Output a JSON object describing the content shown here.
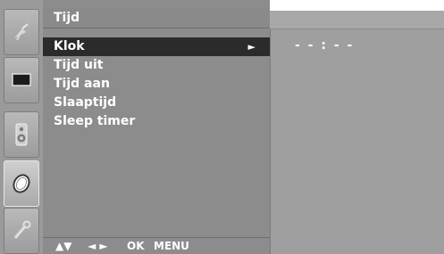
{
  "menu": {
    "title": "Tijd",
    "items": [
      {
        "label": "Klok",
        "arrow": "►",
        "selected": true
      },
      {
        "label": "Tijd uit"
      },
      {
        "label": "Tijd aan"
      },
      {
        "label": "Slaaptijd"
      },
      {
        "label": "Sleep timer"
      }
    ]
  },
  "info": {
    "clock_value": "- - : - -"
  },
  "footer": {
    "nav_updown": "▲▼",
    "nav_leftright": "◄ ►",
    "ok": "OK",
    "menu": "MENU"
  },
  "sidebar": {
    "tabs": [
      {
        "icon": "satellite-dish-icon"
      },
      {
        "icon": "screen-icon"
      },
      {
        "icon": "speaker-icon"
      },
      {
        "icon": "clock-icon",
        "active": true
      },
      {
        "icon": "wrench-icon"
      }
    ]
  }
}
